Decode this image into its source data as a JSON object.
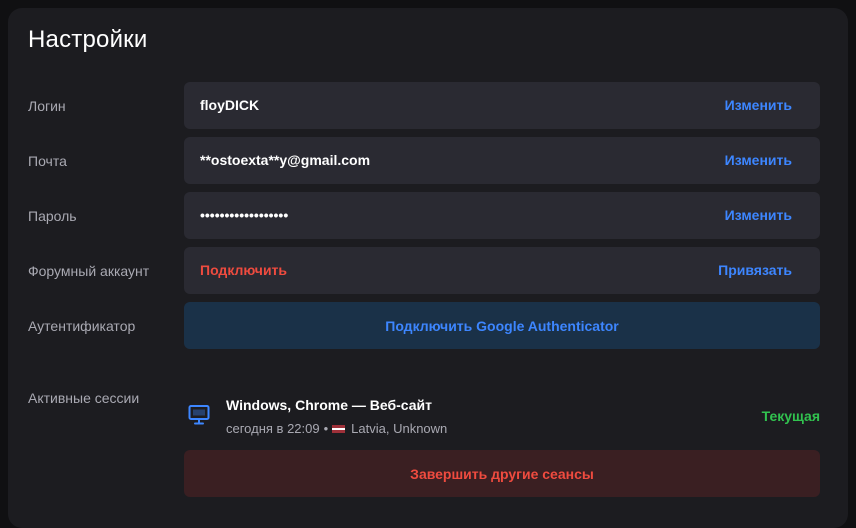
{
  "title": "Настройки",
  "rows": {
    "login": {
      "label": "Логин",
      "value": "floyDICK",
      "action": "Изменить"
    },
    "email": {
      "label": "Почта",
      "value": "**ostoexta**y@gmail.com",
      "action": "Изменить"
    },
    "password": {
      "label": "Пароль",
      "value": "••••••••••••••••••",
      "action": "Изменить"
    },
    "forum": {
      "label": "Форумный аккаунт",
      "value": "Подключить",
      "action": "Привязать"
    },
    "authenticator": {
      "label": "Аутентификатор",
      "button": "Подключить Google Authenticator"
    }
  },
  "sessions": {
    "label": "Активные сессии",
    "items": [
      {
        "title": "Windows, Chrome — Веб-сайт",
        "time": "сегодня в 22:09",
        "separator": "•",
        "location": "Latvia, Unknown",
        "status": "Текущая",
        "icon": "monitor-icon",
        "flag": "latvia-flag-icon"
      }
    ],
    "end_button": "Завершить другие сеансы"
  },
  "colors": {
    "accent": "#3d86ff",
    "danger": "#ef4b3f",
    "success": "#31c24f",
    "panel": "#1c1c20",
    "field": "#2a2a32"
  }
}
